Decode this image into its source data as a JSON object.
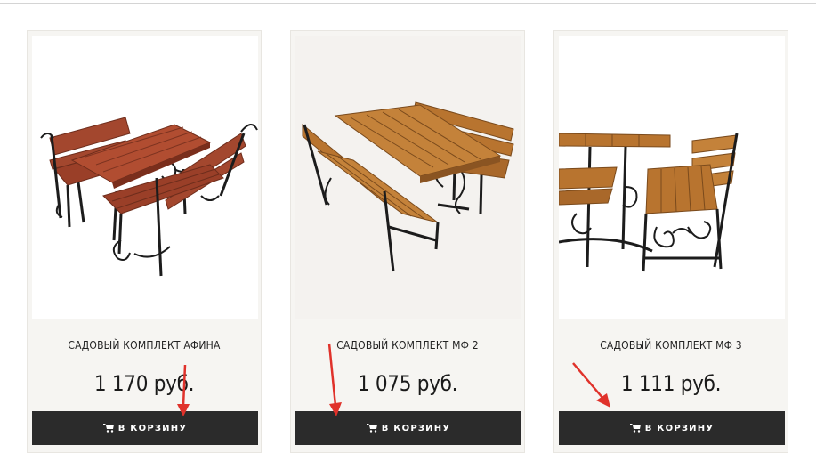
{
  "products": [
    {
      "title": "САДОВЫЙ КОМПЛЕКТ АФИНА",
      "price": "1 170 руб.",
      "button_label": "В КОРЗИНУ",
      "icon": "cart-icon"
    },
    {
      "title": "САДОВЫЙ КОМПЛЕКТ МФ 2",
      "price": "1 075 руб.",
      "button_label": "В КОРЗИНУ",
      "icon": "cart-icon"
    },
    {
      "title": "САДОВЫЙ КОМПЛЕКТ МФ 3",
      "price": "1 111 руб.",
      "button_label": "В КОРЗИНУ",
      "icon": "cart-icon"
    }
  ],
  "colors": {
    "button_bg": "#2b2b2b",
    "card_bg": "#f6f5f2",
    "annotation_arrow": "#e0322b",
    "wood_red": "#a3472e",
    "wood_oak": "#b8742f"
  }
}
